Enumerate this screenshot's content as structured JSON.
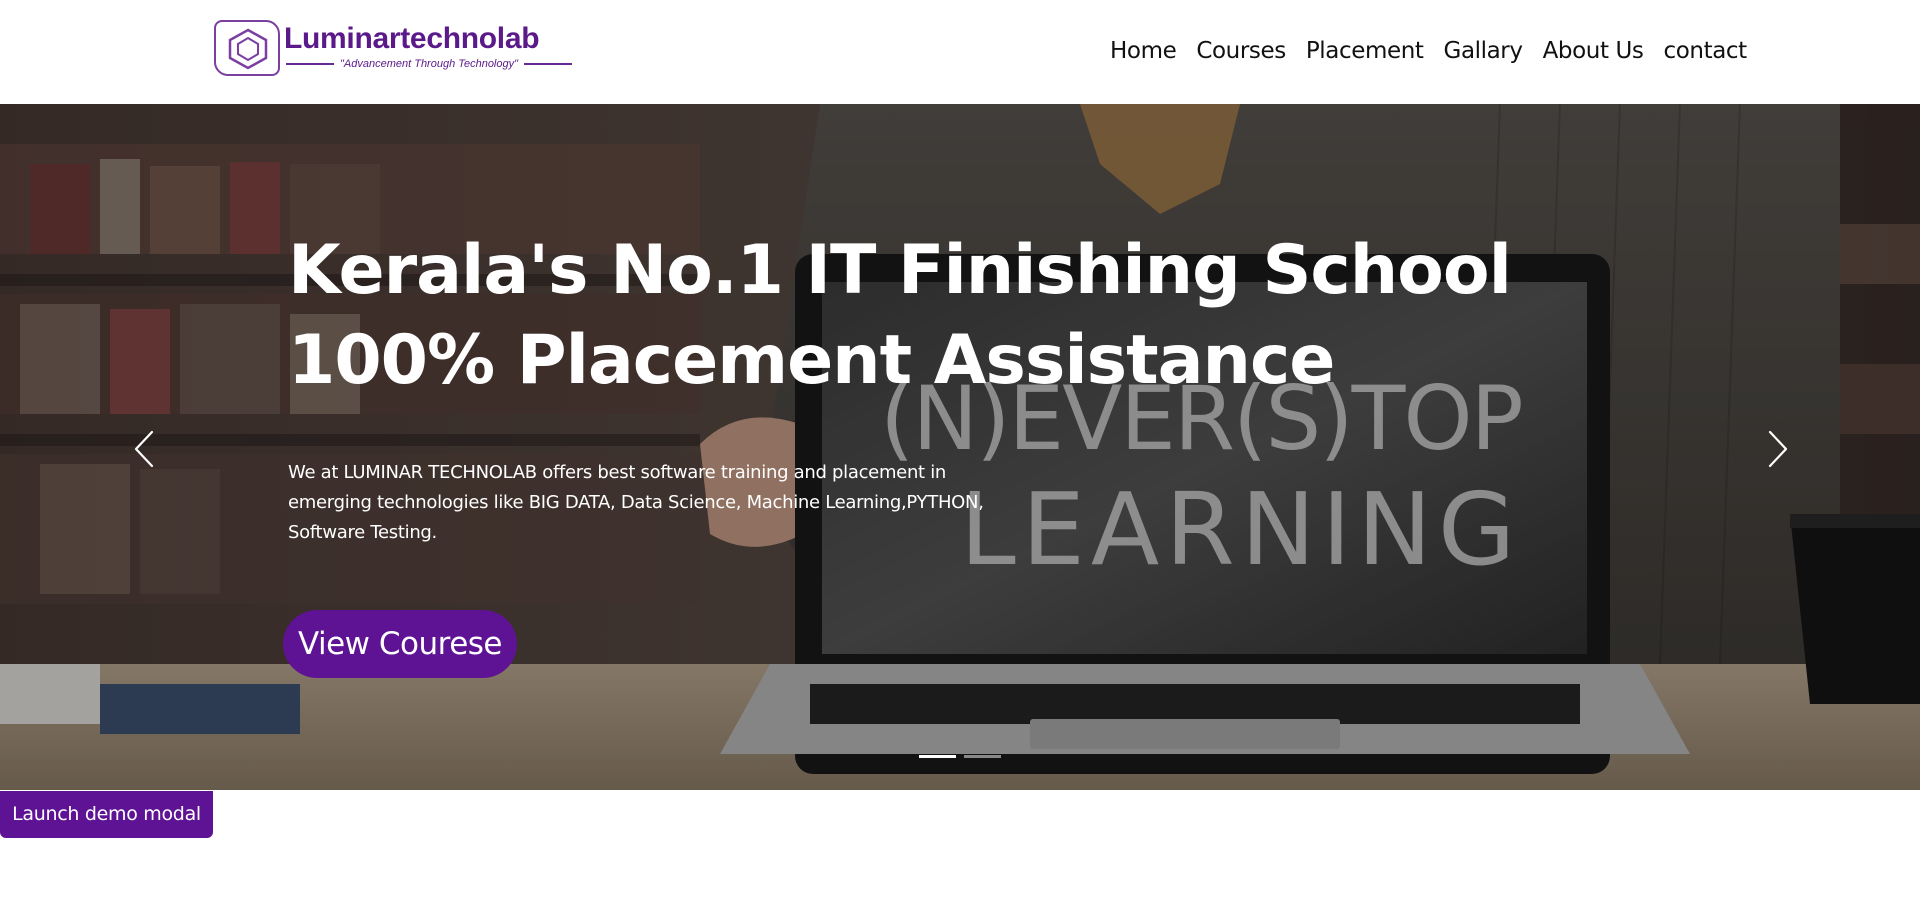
{
  "brand": {
    "name": "Luminartechnolab",
    "tagline": "\"Advancement Through Technology\"",
    "color": "#5b1a8a"
  },
  "nav": {
    "items": [
      "Home",
      "Courses",
      "Placement",
      "Gallary",
      "About Us",
      "contact"
    ]
  },
  "hero": {
    "title_line1": "Kerala's No.1 IT Finishing School",
    "title_line2": "100% Placement Assistance",
    "description": "We at LUMINAR TECHNOLAB offers best software training and placement in emerging technologies like BIG DATA, Data Science, Machine Learning,PYTHON, Software Testing.",
    "button_label": "View Courese",
    "slides_total": 2,
    "active_slide": 1,
    "chalkboard_text_line1": "(N)EVER(S)TOP",
    "chalkboard_text_line2": "LEARNING"
  },
  "modal": {
    "launch_label": "Launch demo modal"
  },
  "colors": {
    "accent": "#5e1294",
    "text_dark": "#111111",
    "white": "#ffffff"
  }
}
